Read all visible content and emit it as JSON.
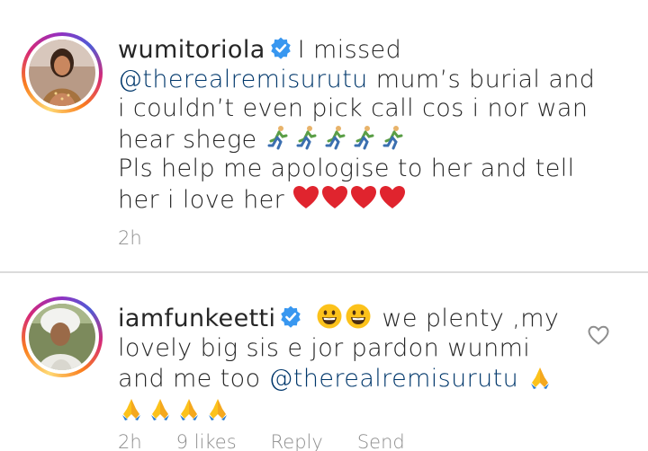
{
  "comments": [
    {
      "username": "wumitoriola",
      "text_1": "I missed",
      "mention_1": "@therealremisurutu",
      "text_2": "mum’s burial and i couldn’t even pick call cos i nor wan hear shege",
      "text_3": "Pls help me apologise to her and tell her i love her",
      "emoji_1": "runner-icon",
      "emoji_2": "red-heart-icon",
      "time": "2h"
    },
    {
      "username": "iamfunkeetti",
      "text_1": "we plenty ,my lovely big sis e jor pardon wunmi and me too",
      "mention_1": "@therealremisurutu",
      "emoji_1": "grinning-face-icon",
      "emoji_2": "folded-hands-icon",
      "time": "2h",
      "likes": "9 likes",
      "reply": "Reply",
      "send": "Send"
    }
  ],
  "colors": {
    "text": "#262626",
    "mention": "#00376b",
    "meta": "#8e8e8e",
    "verified": "#3897f0",
    "divider": "#dbdbdb"
  }
}
